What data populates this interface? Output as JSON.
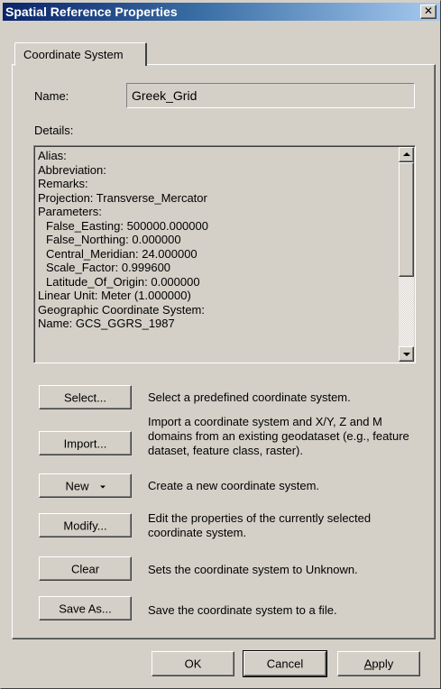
{
  "window": {
    "title": "Spatial Reference Properties",
    "close_symbol": "✕"
  },
  "tabs": [
    {
      "label": "Coordinate System",
      "selected": true
    }
  ],
  "name_section": {
    "label": "Name:",
    "value": "Greek_Grid"
  },
  "details_section": {
    "label": "Details:",
    "lines": [
      {
        "text": "Alias:",
        "indent": false
      },
      {
        "text": "Abbreviation:",
        "indent": false
      },
      {
        "text": "Remarks:",
        "indent": false
      },
      {
        "text": "Projection: Transverse_Mercator",
        "indent": false
      },
      {
        "text": "Parameters:",
        "indent": false
      },
      {
        "text": "False_Easting: 500000.000000",
        "indent": true
      },
      {
        "text": "False_Northing: 0.000000",
        "indent": true
      },
      {
        "text": "Central_Meridian: 24.000000",
        "indent": true
      },
      {
        "text": "Scale_Factor: 0.999600",
        "indent": true
      },
      {
        "text": "Latitude_Of_Origin: 0.000000",
        "indent": true
      },
      {
        "text": "Linear Unit: Meter (1.000000)",
        "indent": false
      },
      {
        "text": "Geographic Coordinate System:",
        "indent": false
      },
      {
        "text": "Name: GCS_GGRS_1987",
        "indent": false
      }
    ],
    "scrollbar": {
      "thumb_position": 0.0
    }
  },
  "actions": {
    "select": {
      "label": "Select...",
      "description": "Select a predefined coordinate system."
    },
    "import": {
      "label": "Import...",
      "description": "Import a coordinate system and X/Y, Z and M domains from an existing geodataset (e.g., feature dataset, feature class, raster)."
    },
    "new": {
      "label": "New",
      "description": "Create a new coordinate system."
    },
    "modify": {
      "label": "Modify...",
      "description": "Edit the properties of the currently selected coordinate system."
    },
    "clear": {
      "label": "Clear",
      "description": "Sets the coordinate system to Unknown."
    },
    "save_as": {
      "label": "Save As...",
      "description": "Save the coordinate system to a file."
    }
  },
  "footer": {
    "ok": "OK",
    "cancel": "Cancel",
    "apply_accel": "A",
    "apply_rest": "pply"
  },
  "colors": {
    "title_gradient_start": "#0a246a",
    "title_gradient_end": "#a6caf0",
    "face": "#d4d0c8"
  },
  "icons": {
    "close": "close-icon",
    "scroll_up": "scroll-up-arrow-icon",
    "scroll_down": "scroll-down-arrow-icon",
    "dropdown": "dropdown-arrow-icon"
  }
}
